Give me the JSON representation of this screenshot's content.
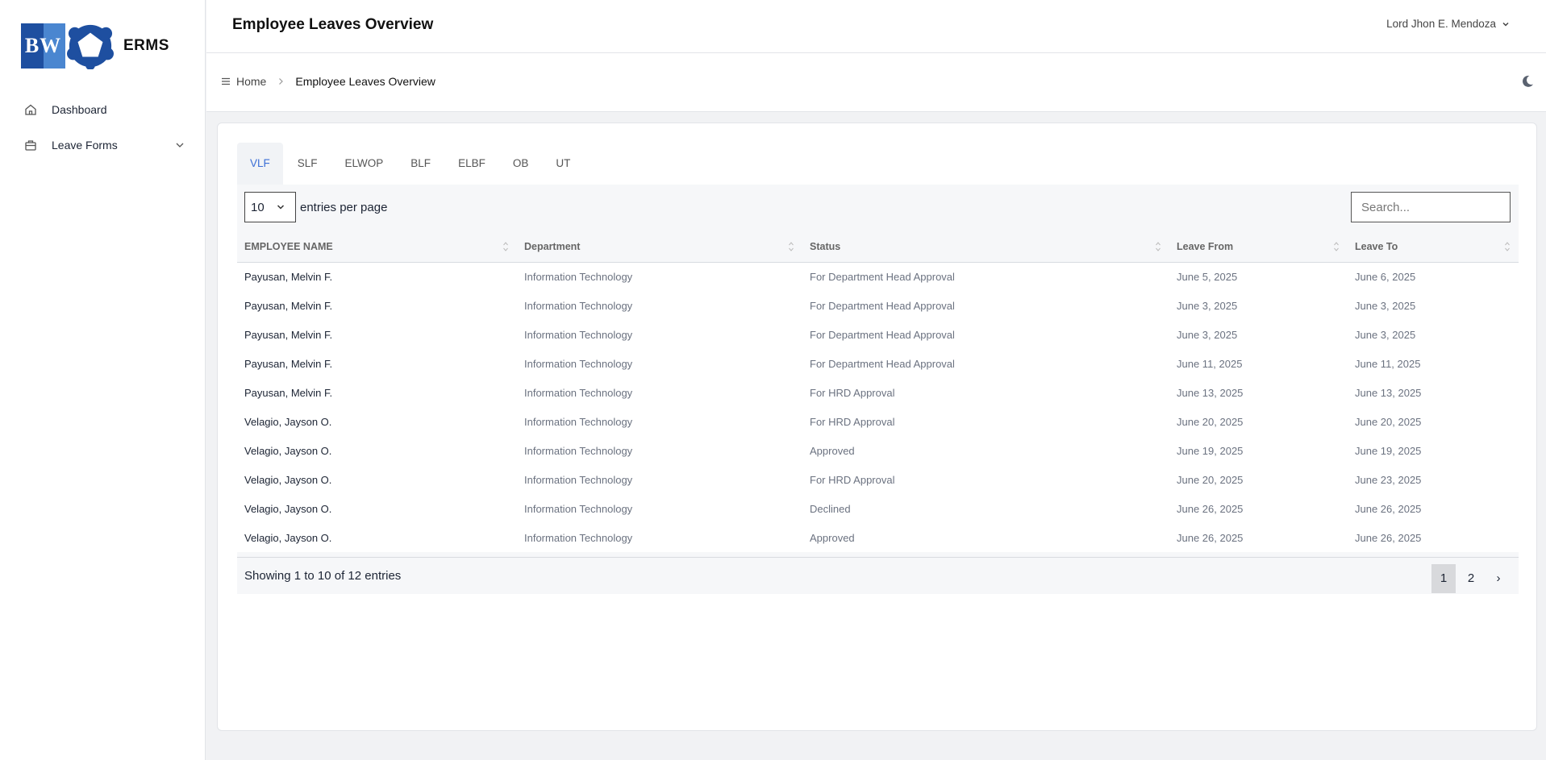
{
  "app": {
    "logo_letters": "BW",
    "name": "ERMS"
  },
  "sidebar": {
    "items": [
      {
        "label": "Dashboard",
        "icon": "home-icon"
      },
      {
        "label": "Leave Forms",
        "icon": "briefcase-icon"
      }
    ]
  },
  "header": {
    "title": "Employee Leaves Overview",
    "user": "Lord Jhon E. Mendoza"
  },
  "breadcrumb": {
    "home": "Home",
    "current": "Employee Leaves Overview"
  },
  "tabs": [
    "VLF",
    "SLF",
    "ELWOP",
    "BLF",
    "ELBF",
    "OB",
    "UT"
  ],
  "active_tab": "VLF",
  "table": {
    "entries_value": "10",
    "entries_label": "entries per page",
    "search_placeholder": "Search...",
    "columns": [
      "EMPLOYEE NAME",
      "Department",
      "Status",
      "Leave From",
      "Leave To"
    ],
    "rows": [
      [
        "Payusan, Melvin F.",
        "Information Technology",
        "For Department Head Approval",
        "June 5, 2025",
        "June 6, 2025"
      ],
      [
        "Payusan, Melvin F.",
        "Information Technology",
        "For Department Head Approval",
        "June 3, 2025",
        "June 3, 2025"
      ],
      [
        "Payusan, Melvin F.",
        "Information Technology",
        "For Department Head Approval",
        "June 3, 2025",
        "June 3, 2025"
      ],
      [
        "Payusan, Melvin F.",
        "Information Technology",
        "For Department Head Approval",
        "June 11, 2025",
        "June 11, 2025"
      ],
      [
        "Payusan, Melvin F.",
        "Information Technology",
        "For HRD Approval",
        "June 13, 2025",
        "June 13, 2025"
      ],
      [
        "Velagio, Jayson O.",
        "Information Technology",
        "For HRD Approval",
        "June 20, 2025",
        "June 20, 2025"
      ],
      [
        "Velagio, Jayson O.",
        "Information Technology",
        "Approved",
        "June 19, 2025",
        "June 19, 2025"
      ],
      [
        "Velagio, Jayson O.",
        "Information Technology",
        "For HRD Approval",
        "June 20, 2025",
        "June 23, 2025"
      ],
      [
        "Velagio, Jayson O.",
        "Information Technology",
        "Declined",
        "June 26, 2025",
        "June 26, 2025"
      ],
      [
        "Velagio, Jayson O.",
        "Information Technology",
        "Approved",
        "June 26, 2025",
        "June 26, 2025"
      ]
    ],
    "showing": "Showing 1 to 10 of 12 entries",
    "pages": [
      "1",
      "2"
    ],
    "next_label": "›",
    "current_page": "1"
  },
  "colors": {
    "accent": "#3c6fd6",
    "logo_dark": "#1e4fa0",
    "logo_light": "#4a86d0"
  }
}
